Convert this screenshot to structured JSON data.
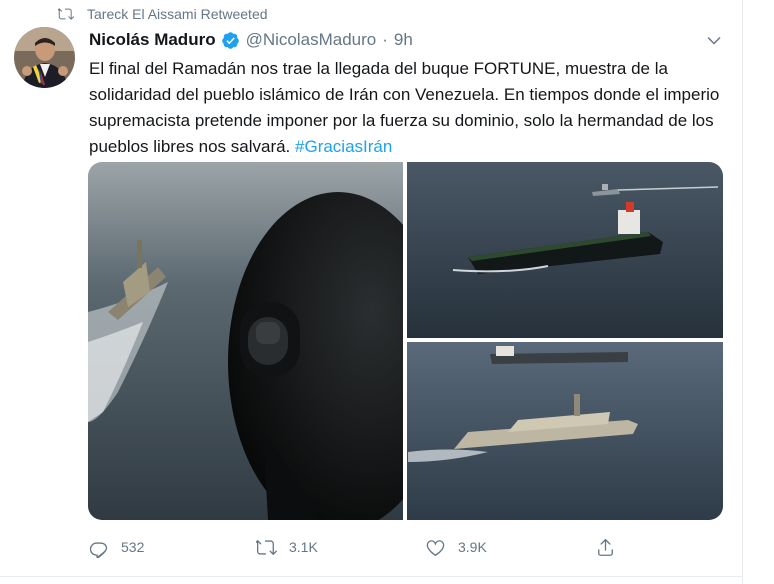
{
  "retweet": {
    "text": "Tareck El Aissami Retweeted"
  },
  "author": {
    "name": "Nicolás Maduro",
    "handle": "@NicolasMaduro",
    "separator": "·",
    "time": "9h"
  },
  "tweet": {
    "text": "El final del Ramadán nos trae la llegada del buque FORTUNE, muestra de la solidaridad del pueblo islámico de Irán con Venezuela. En tiempos donde el imperio supremacista pretende imponer por la fuerza su dominio, solo la hermandad de los pueblos libres nos salvará.",
    "hashtag": "#GraciasIrán"
  },
  "actions": {
    "replies": "532",
    "retweets": "3.1K",
    "likes": "3.9K"
  },
  "colors": {
    "accent": "#1da1f2",
    "muted": "#657786",
    "text": "#14171a",
    "border": "#e6ecf0"
  },
  "icons": [
    "retweet-icon",
    "verified-badge-icon",
    "chevron-down-icon",
    "reply-icon",
    "retweet-icon",
    "like-icon",
    "share-icon"
  ]
}
